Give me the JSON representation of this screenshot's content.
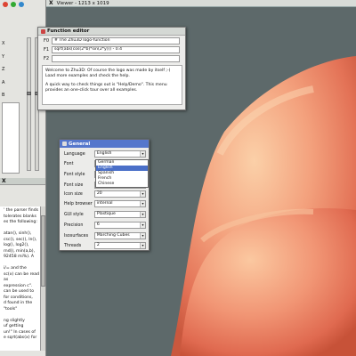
{
  "viewer": {
    "title": "Viewer - 1213 x 1019",
    "close_glyph": "X"
  },
  "left_panel": {
    "axis_labels": [
      "X",
      "Y",
      "Z",
      "A",
      "B"
    ],
    "icons": [
      {
        "name": "help-icon",
        "color": "#d43"
      },
      {
        "name": "refresh-icon",
        "color": "#3a3"
      },
      {
        "name": "info-icon",
        "color": "#38c"
      }
    ]
  },
  "help": {
    "close_glyph": "X",
    "lines": [
      "' the parser finds",
      "tolerates blanks",
      "es the following:",
      "",
      "atan(), sinh(),",
      "csc(), sec(), ln(),",
      "log(), log2(),",
      "rnd(), min(a,b),",
      "92458 mi%). A",
      "",
      "i/= and the",
      "sc(x) can be read as",
      "expression c\".",
      "can be used to",
      "for conditions,",
      "d found in the \"tools\"",
      "",
      "ng slightly",
      "uf getting",
      "un!\" In cases of",
      "e sqrt(abs(x) for"
    ]
  },
  "function_editor": {
    "title": "Function editor",
    "rows": [
      {
        "label": "F0",
        "value": "# The Zhu3D logo-function"
      },
      {
        "label": "F1",
        "value": "sqrt(abs(cos(2*b)*sin(2*y))) - 0.4"
      },
      {
        "label": "F2",
        "value": ""
      }
    ],
    "description_1": "Welcome to Zhu3D: Of course the logo was made by itself ;-) Load more examples and check the help.",
    "description_2": "A quick way to check things out is \"Help/Demo\". This menu provides an one-click tour over all examples."
  },
  "general": {
    "title": "General",
    "fields": [
      {
        "label": "Language",
        "value": "English",
        "kind": "select"
      },
      {
        "label": "Font",
        "value": "",
        "kind": "select"
      },
      {
        "label": "Font style",
        "value": "",
        "kind": "select"
      },
      {
        "label": "Font size",
        "value": "",
        "kind": "select"
      },
      {
        "label": "Icon size",
        "value": "20",
        "kind": "spin"
      },
      {
        "label": "Help browser",
        "value": "internal",
        "kind": "select"
      },
      {
        "label": "GUI style",
        "value": "Plastique",
        "kind": "select"
      },
      {
        "label": "Precision",
        "value": "6",
        "kind": "spin"
      },
      {
        "label": "Isosurfaces",
        "value": "Marching Cubes",
        "kind": "select"
      },
      {
        "label": "Threads",
        "value": "2",
        "kind": "spin"
      }
    ],
    "language_options": [
      "German",
      "English",
      "Spanish",
      "French",
      "Chinese"
    ],
    "language_selected_index": 1,
    "arrow_glyph": "▾"
  }
}
